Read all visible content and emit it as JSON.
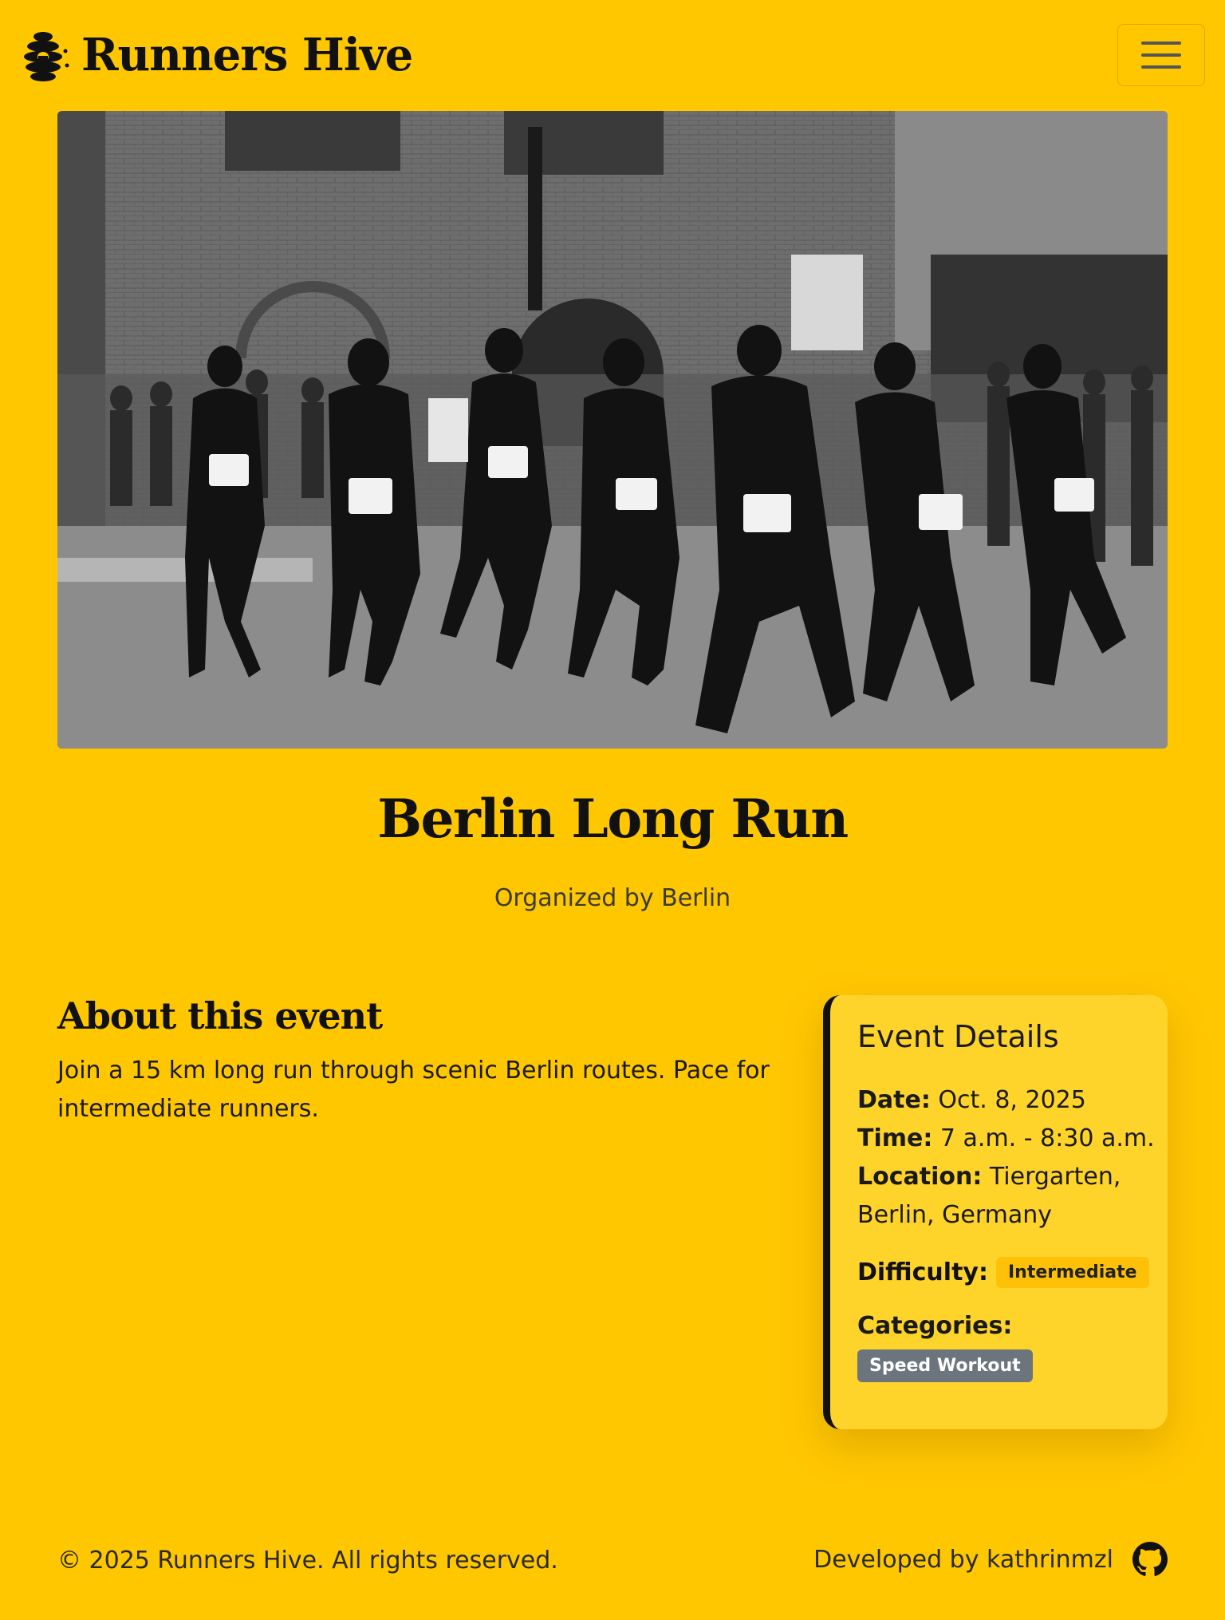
{
  "site": {
    "brand_name": "Runners Hive",
    "logo_icon": "beehive-icon",
    "menu_icon": "hamburger-menu-icon"
  },
  "hero": {
    "alt": "Black and white photo of marathon runners on a city street"
  },
  "event": {
    "title": "Berlin Long Run",
    "organizer": "Organized by Berlin",
    "about_heading": "About this event",
    "about_text": "Join a 15 km long run through scenic Berlin routes. Pace for intermediate runners."
  },
  "details": {
    "title": "Event Details",
    "date_label": "Date:",
    "date_value": "Oct. 8, 2025",
    "time_label": "Time:",
    "time_value": "7 a.m. - 8:30 a.m.",
    "location_label": "Location:",
    "location_value": "Tiergarten, Berlin, Germany",
    "difficulty_label": "Difficulty:",
    "difficulty_value": "Intermediate",
    "categories_label": "Categories:",
    "categories": [
      "Speed Workout"
    ]
  },
  "footer": {
    "copyright": "© 2025 Runners Hive. All rights reserved.",
    "developer": "Developed by kathrinmzl",
    "github_icon": "github-icon"
  },
  "colors": {
    "background": "#FFC700",
    "card": "#FFD42A",
    "badge_difficulty": "#FFC107",
    "badge_category": "#6C757D",
    "text": "#111111"
  }
}
